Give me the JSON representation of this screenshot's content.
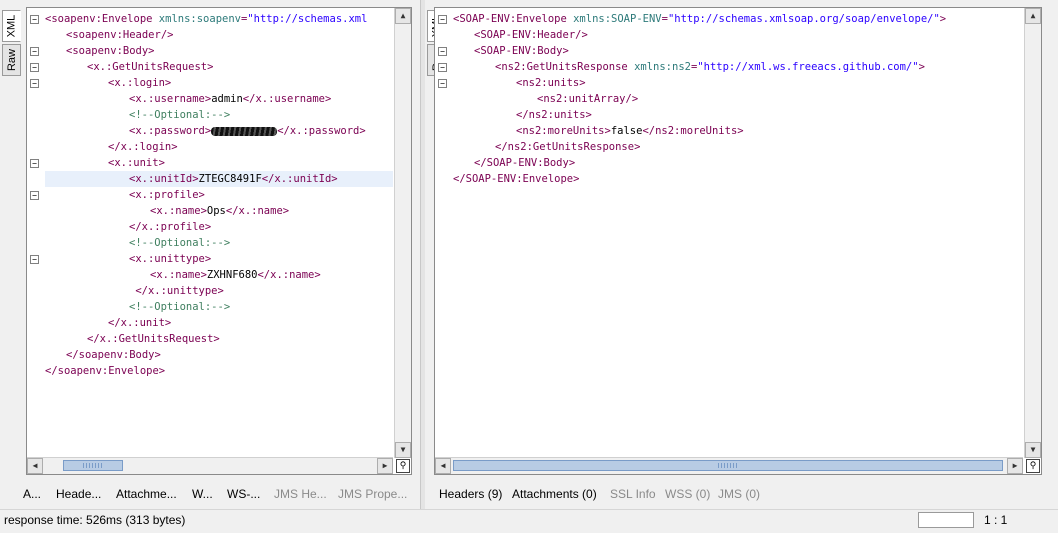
{
  "request": {
    "tabs": {
      "xml": "XML",
      "raw": "Raw"
    },
    "lines": [
      {
        "indent": 0,
        "fold": "-",
        "parts": [
          [
            "tag",
            "<soapenv:Envelope "
          ],
          [
            "attr",
            "xmlns:soapenv"
          ],
          [
            "tag",
            "="
          ],
          [
            "val",
            "\"http://schemas.xml"
          ]
        ]
      },
      {
        "indent": 1,
        "fold": "",
        "parts": [
          [
            "tag",
            "<soapenv:Header/>"
          ]
        ]
      },
      {
        "indent": 1,
        "fold": "-",
        "parts": [
          [
            "tag",
            "<soapenv:Body>"
          ]
        ]
      },
      {
        "indent": 2,
        "fold": "-",
        "parts": [
          [
            "tag",
            "<x.:GetUnitsRequest>"
          ]
        ]
      },
      {
        "indent": 3,
        "fold": "-",
        "parts": [
          [
            "tag",
            "<x.:login>"
          ]
        ]
      },
      {
        "indent": 4,
        "fold": "",
        "parts": [
          [
            "tag",
            "<x.:username>"
          ],
          [
            "txt",
            "admin"
          ],
          [
            "tag",
            "</x.:username>"
          ]
        ]
      },
      {
        "indent": 4,
        "fold": "",
        "parts": [
          [
            "cmt",
            "<!--Optional:-->"
          ]
        ]
      },
      {
        "indent": 4,
        "fold": "",
        "parts": [
          [
            "tag",
            "<x.:password>"
          ],
          [
            "redact",
            ""
          ],
          [
            "tag",
            "</x.:password>"
          ]
        ]
      },
      {
        "indent": 3,
        "fold": "",
        "parts": [
          [
            "tag",
            "</x.:login>"
          ]
        ]
      },
      {
        "indent": 3,
        "fold": "-",
        "parts": [
          [
            "tag",
            "<x.:unit>"
          ]
        ]
      },
      {
        "indent": 4,
        "fold": "",
        "highlight": true,
        "parts": [
          [
            "tag",
            "<x.:unitId>"
          ],
          [
            "txt",
            "ZTEGC8491F"
          ],
          [
            "tag",
            "</x.:unitId>"
          ]
        ]
      },
      {
        "indent": 4,
        "fold": "-",
        "parts": [
          [
            "tag",
            "<x.:profile>"
          ]
        ]
      },
      {
        "indent": 5,
        "fold": "",
        "parts": [
          [
            "tag",
            "<x.:name>"
          ],
          [
            "txt",
            "Ops"
          ],
          [
            "tag",
            "</x.:name>"
          ]
        ]
      },
      {
        "indent": 4,
        "fold": "",
        "parts": [
          [
            "tag",
            "</x.:profile>"
          ]
        ]
      },
      {
        "indent": 4,
        "fold": "",
        "parts": [
          [
            "cmt",
            "<!--Optional:-->"
          ]
        ]
      },
      {
        "indent": 4,
        "fold": "-",
        "parts": [
          [
            "tag",
            "<x.:unittype>"
          ]
        ]
      },
      {
        "indent": 5,
        "fold": "",
        "parts": [
          [
            "tag",
            "<x.:name>"
          ],
          [
            "txt",
            "ZXHNF680"
          ],
          [
            "tag",
            "</x.:name>"
          ]
        ]
      },
      {
        "indent": 4,
        "fold": "",
        "parts": [
          [
            "tag",
            " </x.:unittype>"
          ]
        ]
      },
      {
        "indent": 4,
        "fold": "",
        "parts": [
          [
            "cmt",
            "<!--Optional:-->"
          ]
        ]
      },
      {
        "indent": 3,
        "fold": "",
        "parts": [
          [
            "tag",
            "</x.:unit>"
          ]
        ]
      },
      {
        "indent": 2,
        "fold": "",
        "parts": [
          [
            "tag",
            "</x.:GetUnitsRequest>"
          ]
        ]
      },
      {
        "indent": 1,
        "fold": "",
        "parts": [
          [
            "tag",
            "</soapenv:Body>"
          ]
        ]
      },
      {
        "indent": 0,
        "fold": "",
        "parts": [
          [
            "tag",
            "</soapenv:Envelope>"
          ]
        ]
      }
    ],
    "bottom_tabs": [
      {
        "label": "A...",
        "enabled": true
      },
      {
        "label": "Heade...",
        "enabled": true
      },
      {
        "label": "Attachme...",
        "enabled": true
      },
      {
        "label": "W...",
        "enabled": true
      },
      {
        "label": "WS-...",
        "enabled": true
      },
      {
        "label": "JMS He...",
        "enabled": false
      },
      {
        "label": "JMS Prope...",
        "enabled": false
      }
    ]
  },
  "response": {
    "tabs": {
      "xml": "XML",
      "raw": "Raw"
    },
    "lines": [
      {
        "indent": 0,
        "fold": "-",
        "parts": [
          [
            "tag",
            "<SOAP-ENV:Envelope "
          ],
          [
            "attr",
            "xmlns:SOAP-ENV"
          ],
          [
            "tag",
            "="
          ],
          [
            "val",
            "\"http://schemas.xmlsoap.org/soap/envelope/\""
          ],
          [
            "tag",
            ">"
          ]
        ]
      },
      {
        "indent": 1,
        "fold": "",
        "parts": [
          [
            "tag",
            "<SOAP-ENV:Header/>"
          ]
        ]
      },
      {
        "indent": 1,
        "fold": "-",
        "parts": [
          [
            "tag",
            "<SOAP-ENV:Body>"
          ]
        ]
      },
      {
        "indent": 2,
        "fold": "-",
        "parts": [
          [
            "tag",
            "<ns2:GetUnitsResponse "
          ],
          [
            "attr",
            "xmlns:ns2"
          ],
          [
            "tag",
            "="
          ],
          [
            "val",
            "\"http://xml.ws.freeacs.github.com/\""
          ],
          [
            "tag",
            ">"
          ]
        ]
      },
      {
        "indent": 3,
        "fold": "-",
        "parts": [
          [
            "tag",
            "<ns2:units>"
          ]
        ]
      },
      {
        "indent": 4,
        "fold": "",
        "parts": [
          [
            "tag",
            "<ns2:unitArray/>"
          ]
        ]
      },
      {
        "indent": 3,
        "fold": "",
        "parts": [
          [
            "tag",
            "</ns2:units>"
          ]
        ]
      },
      {
        "indent": 3,
        "fold": "",
        "parts": [
          [
            "tag",
            "<ns2:moreUnits>"
          ],
          [
            "txt",
            "false"
          ],
          [
            "tag",
            "</ns2:moreUnits>"
          ]
        ]
      },
      {
        "indent": 2,
        "fold": "",
        "parts": [
          [
            "tag",
            "</ns2:GetUnitsResponse>"
          ]
        ]
      },
      {
        "indent": 1,
        "fold": "",
        "parts": [
          [
            "tag",
            "</SOAP-ENV:Body>"
          ]
        ]
      },
      {
        "indent": 0,
        "fold": "",
        "parts": [
          [
            "tag",
            "</SOAP-ENV:Envelope>"
          ]
        ]
      }
    ],
    "bottom_tabs": [
      {
        "label": "Headers (9)",
        "enabled": true
      },
      {
        "label": "Attachments (0)",
        "enabled": true
      },
      {
        "label": "SSL Info",
        "enabled": false
      },
      {
        "label": "WSS (0)",
        "enabled": false
      },
      {
        "label": "JMS (0)",
        "enabled": false
      }
    ]
  },
  "status": {
    "response_time": "response time: 526ms (313 bytes)",
    "cursor_pos": "1 : 1"
  },
  "colors": {
    "tag": "#7b0052",
    "attr": "#2d7a7a",
    "value": "#2a00ff",
    "comment": "#3f7f5f"
  },
  "icons": {
    "fold_expanded": "minus-box-icon",
    "scroll_up": "arrow-up-icon",
    "scroll_down": "arrow-down-icon",
    "zoom": "magnifier-icon"
  }
}
